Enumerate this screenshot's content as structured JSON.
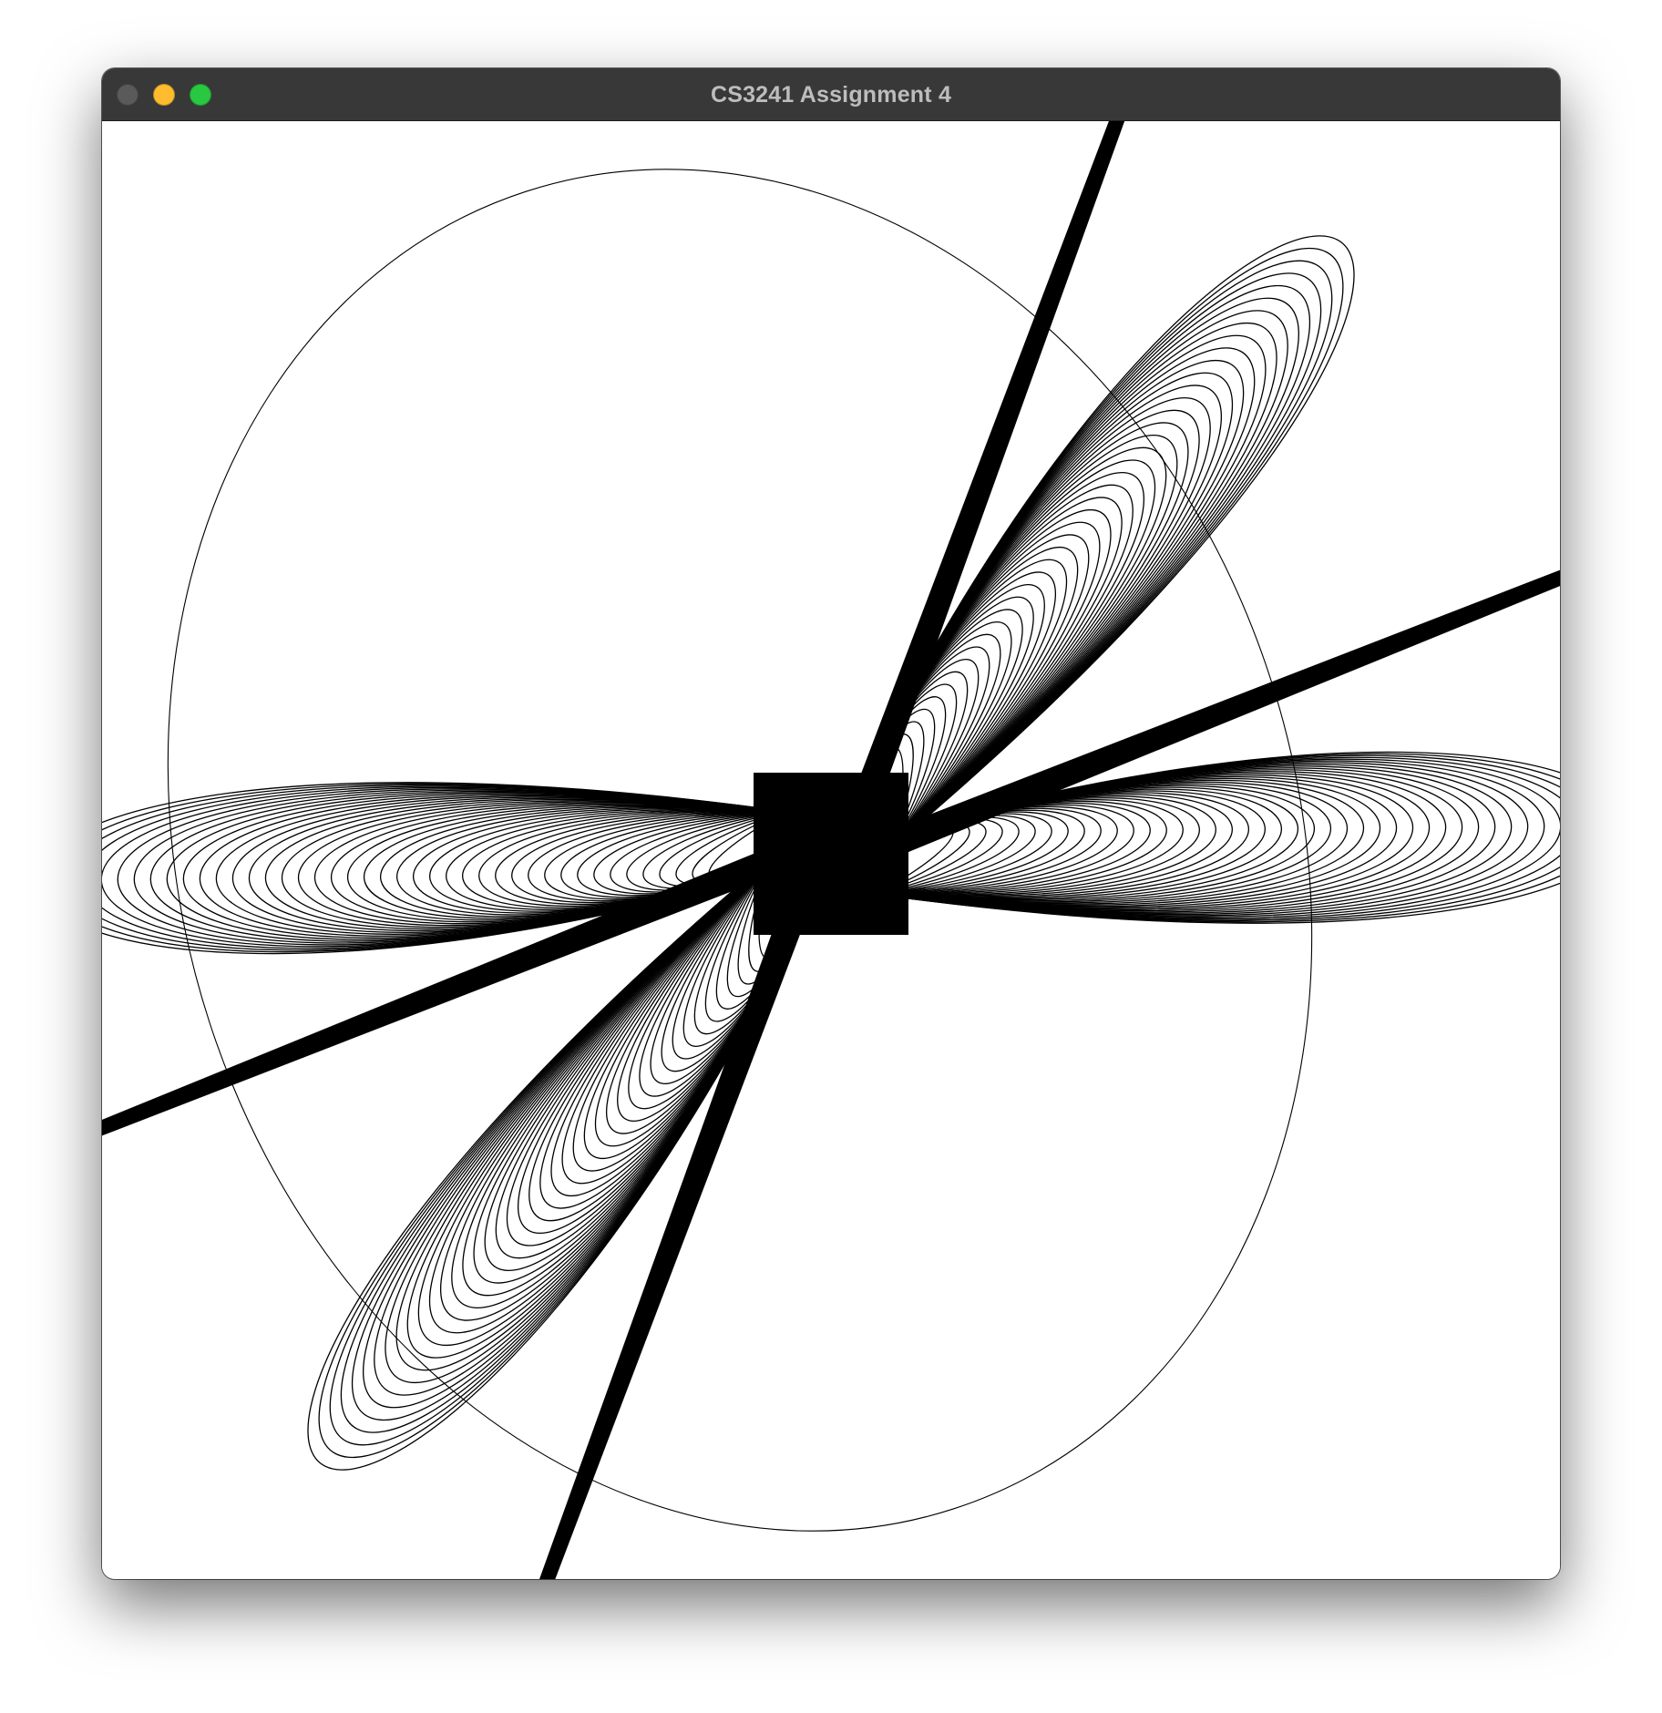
{
  "window": {
    "title": "CS3241 Assignment 4",
    "controls": {
      "close_color": "#5a5a5a",
      "minimize_color": "#febc2e",
      "maximize_color": "#28c840"
    },
    "titlebar_color": "#383838"
  },
  "canvas": {
    "background": "#ffffff",
    "stroke_color": "#000000",
    "content": "petal-curve-pattern"
  }
}
